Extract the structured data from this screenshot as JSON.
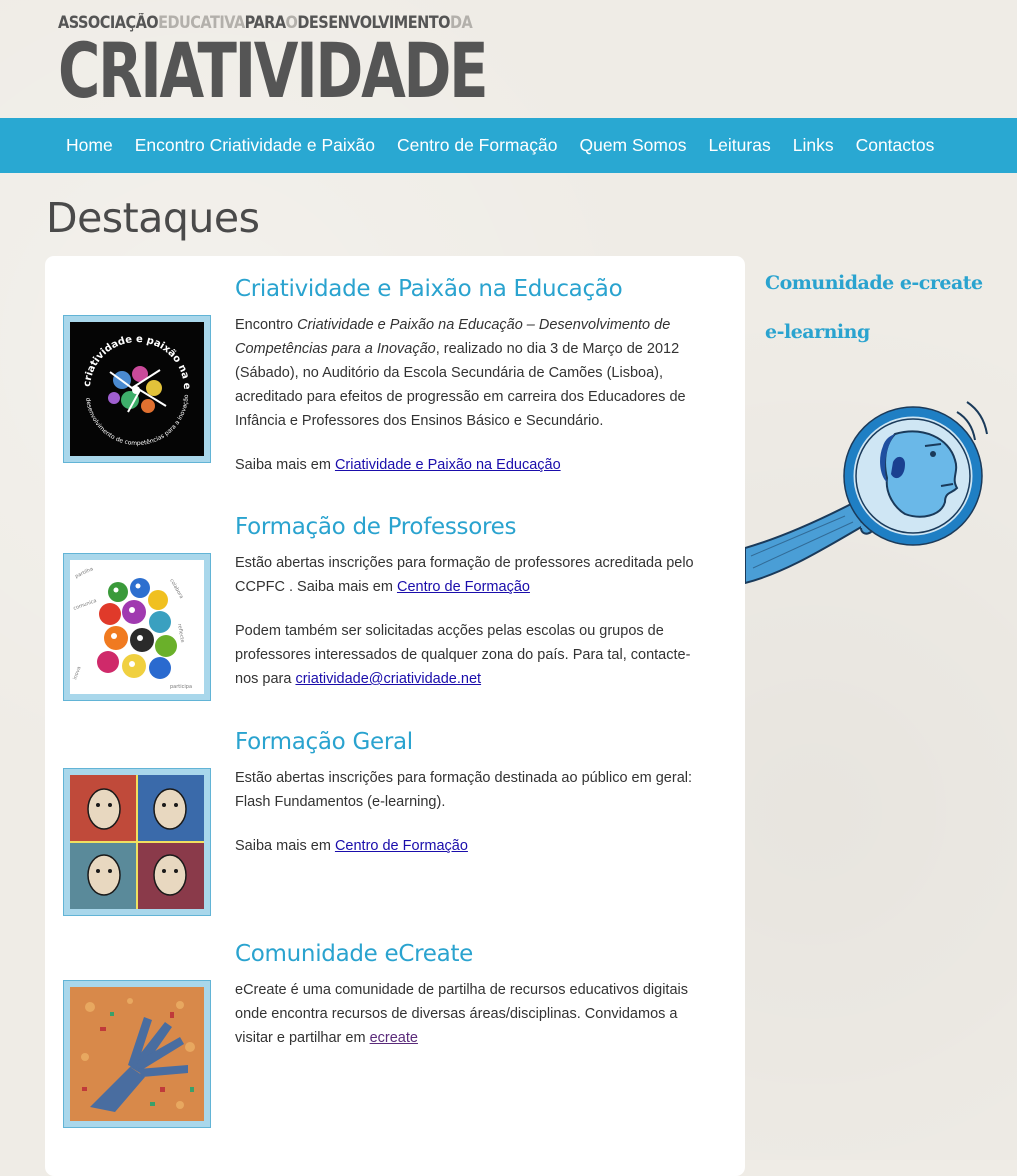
{
  "logo": {
    "line1_parts": [
      {
        "text": "ASSOCIAÇÃO",
        "tone": "dark"
      },
      {
        "text": "EDUCATIVA",
        "tone": "light"
      },
      {
        "text": "PARA",
        "tone": "dark"
      },
      {
        "text": "O",
        "tone": "light"
      },
      {
        "text": "DESENVOLVIMENTO",
        "tone": "dark"
      },
      {
        "text": "DA",
        "tone": "light"
      }
    ],
    "main": "CRIATIVIDADE"
  },
  "nav": {
    "items": [
      "Home",
      "Encontro Criatividade e Paixão",
      "Centro de Formação",
      "Quem Somos",
      "Leituras",
      "Links",
      "Contactos"
    ]
  },
  "page": {
    "title": "Destaques"
  },
  "items": [
    {
      "title": "Criatividade e Paixão na Educação",
      "p1_pre": "Encontro ",
      "p1_em": "Criatividade e Paixão na Educação – Desenvolvimento de Competências para a Inovação",
      "p1_post": ", realizado no dia 3 de Março de 2012 (Sábado), no Auditório da Escola Secundária de Camões (Lisboa), acreditado para  efeitos de progressão em carreira dos Educadores de Infância e Professores dos Ensinos Básico e Secundário.",
      "p2_pre": "Saiba mais em ",
      "p2_link": "Criatividade e Paixão na Educação",
      "thumb_text_top": "criatividade e paixão na educação",
      "thumb_text_bottom": "desenvolvimento de competências para a inovação"
    },
    {
      "title": "Formação de Professores",
      "p1_pre": "Estão abertas inscrições para formação de professores acreditada pelo CCPFC .  Saiba mais em ",
      "p1_link": "Centro de Formação",
      "p2_pre": "Podem também ser solicitadas acções pelas escolas ou grupos de professores interessados de qualquer zona do país. Para tal, contacte-nos para ",
      "p2_link": "criatividade@criatividade.net"
    },
    {
      "title": "Formação Geral",
      "p1": "Estão abertas inscrições para formação destinada ao público em geral: Flash Fundamentos (e-learning).",
      "p2_pre": "Saiba mais em ",
      "p2_link": "Centro de Formação"
    },
    {
      "title": "Comunidade eCreate",
      "p1_pre": "eCreate é uma comunidade de partilha de recursos educativos digitais onde encontra recursos de diversas áreas/disciplinas. Convidamos a visitar e partilhar em ",
      "p1_link": "ecreate"
    }
  ],
  "sidebar": {
    "links": [
      "Comunidade e-create",
      "e-learning"
    ]
  },
  "colors": {
    "accent": "#29a8d2",
    "heading_blue": "#2aa3cf",
    "background": "#efece6",
    "link": "#1a0dab"
  }
}
